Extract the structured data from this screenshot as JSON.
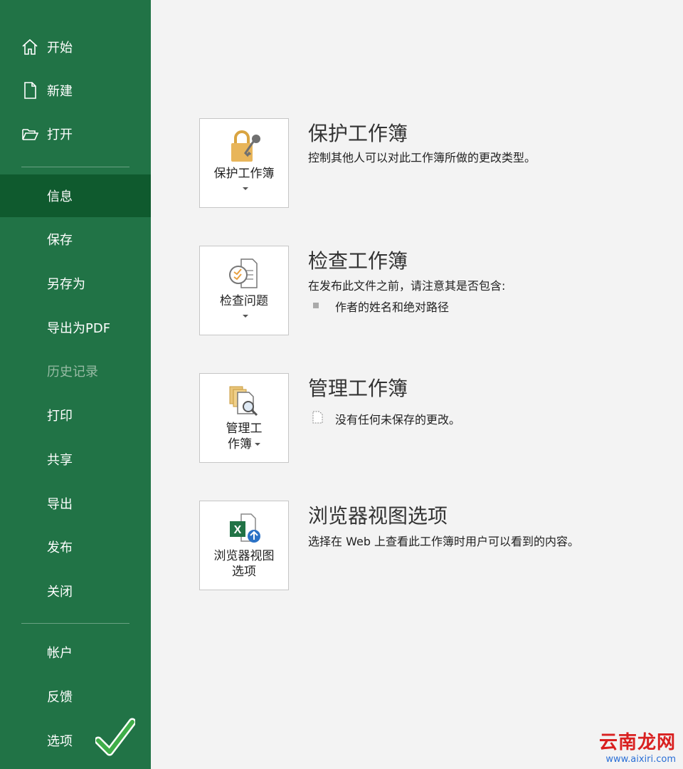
{
  "sidebar": {
    "home": "开始",
    "new": "新建",
    "open": "打开",
    "info": "信息",
    "save": "保存",
    "save_as": "另存为",
    "export_pdf": "导出为PDF",
    "history": "历史记录",
    "print": "打印",
    "share": "共享",
    "export": "导出",
    "publish": "发布",
    "close": "关闭",
    "account": "帐户",
    "feedback": "反馈",
    "options": "选项"
  },
  "sections": {
    "protect": {
      "button": "保护工作簿",
      "title": "保护工作簿",
      "description": "控制其他人可以对此工作簿所做的更改类型。"
    },
    "inspect": {
      "button": "检查问题",
      "title": "检查工作簿",
      "description": "在发布此文件之前，请注意其是否包含:",
      "bullet": "作者的姓名和绝对路径"
    },
    "manage": {
      "button_line1": "管理工",
      "button_line2": "作簿",
      "title": "管理工作簿",
      "description": "没有任何未保存的更改。"
    },
    "browser": {
      "button_line1": "浏览器视图",
      "button_line2": "选项",
      "title": "浏览器视图选项",
      "description": "选择在 Web 上查看此工作簿时用户可以看到的内容。"
    }
  },
  "watermark": {
    "text": "云南龙网",
    "url": "www.aixiri.com"
  },
  "colors": {
    "sidebar": "#217346",
    "sidebar_active": "#0f5a2e",
    "content_bg": "#f3f3f3"
  },
  "icons": [
    "home-icon",
    "new-doc-icon",
    "open-folder-icon",
    "lock-icon",
    "inspect-icon",
    "manage-icon",
    "browser-view-icon",
    "checkmark-icon"
  ]
}
